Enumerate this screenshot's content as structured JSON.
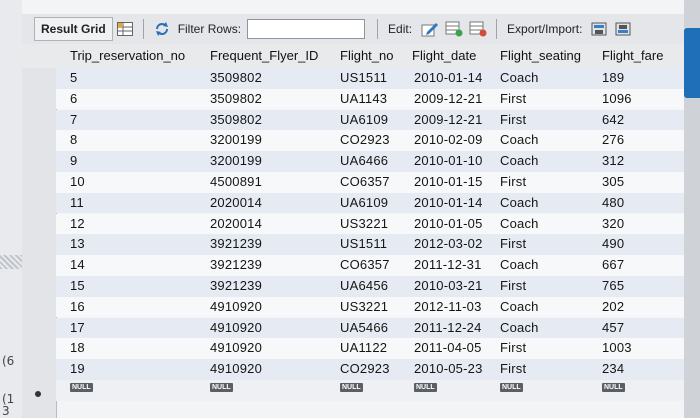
{
  "toolbar": {
    "result_grid_label": "Result Grid",
    "filter_rows_label": "Filter Rows:",
    "filter_value": "",
    "edit_label": "Edit:",
    "export_import_label": "Export/Import:"
  },
  "columns": [
    "Trip_reservation_no",
    "Frequent_Flyer_ID",
    "Flight_no",
    "Flight_date",
    "Flight_seating",
    "Flight_fare"
  ],
  "rows": [
    [
      "5",
      "3509802",
      "US1511",
      "2010-01-14",
      "Coach",
      "189"
    ],
    [
      "6",
      "3509802",
      "UA1143",
      "2009-12-21",
      "First",
      "1096"
    ],
    [
      "7",
      "3509802",
      "UA6109",
      "2009-12-21",
      "First",
      "642"
    ],
    [
      "8",
      "3200199",
      "CO2923",
      "2010-02-09",
      "Coach",
      "276"
    ],
    [
      "9",
      "3200199",
      "UA6466",
      "2010-01-10",
      "Coach",
      "312"
    ],
    [
      "10",
      "4500891",
      "CO6357",
      "2010-01-15",
      "First",
      "305"
    ],
    [
      "11",
      "2020014",
      "UA6109",
      "2010-01-14",
      "Coach",
      "480"
    ],
    [
      "12",
      "2020014",
      "US3221",
      "2010-01-05",
      "Coach",
      "320"
    ],
    [
      "13",
      "3921239",
      "US1511",
      "2012-03-02",
      "First",
      "490"
    ],
    [
      "14",
      "3921239",
      "CO6357",
      "2011-12-31",
      "Coach",
      "667"
    ],
    [
      "15",
      "3921239",
      "UA6456",
      "2010-03-21",
      "First",
      "765"
    ],
    [
      "16",
      "4910920",
      "US3221",
      "2012-11-03",
      "Coach",
      "202"
    ],
    [
      "17",
      "4910920",
      "UA5466",
      "2011-12-24",
      "Coach",
      "457"
    ],
    [
      "18",
      "4910920",
      "UA1122",
      "2011-04-05",
      "First",
      "1003"
    ],
    [
      "19",
      "4910920",
      "CO2923",
      "2010-05-23",
      "First",
      "234"
    ]
  ],
  "null_label": "NULL",
  "left_fragments": [
    "(6",
    "(1",
    "3"
  ]
}
